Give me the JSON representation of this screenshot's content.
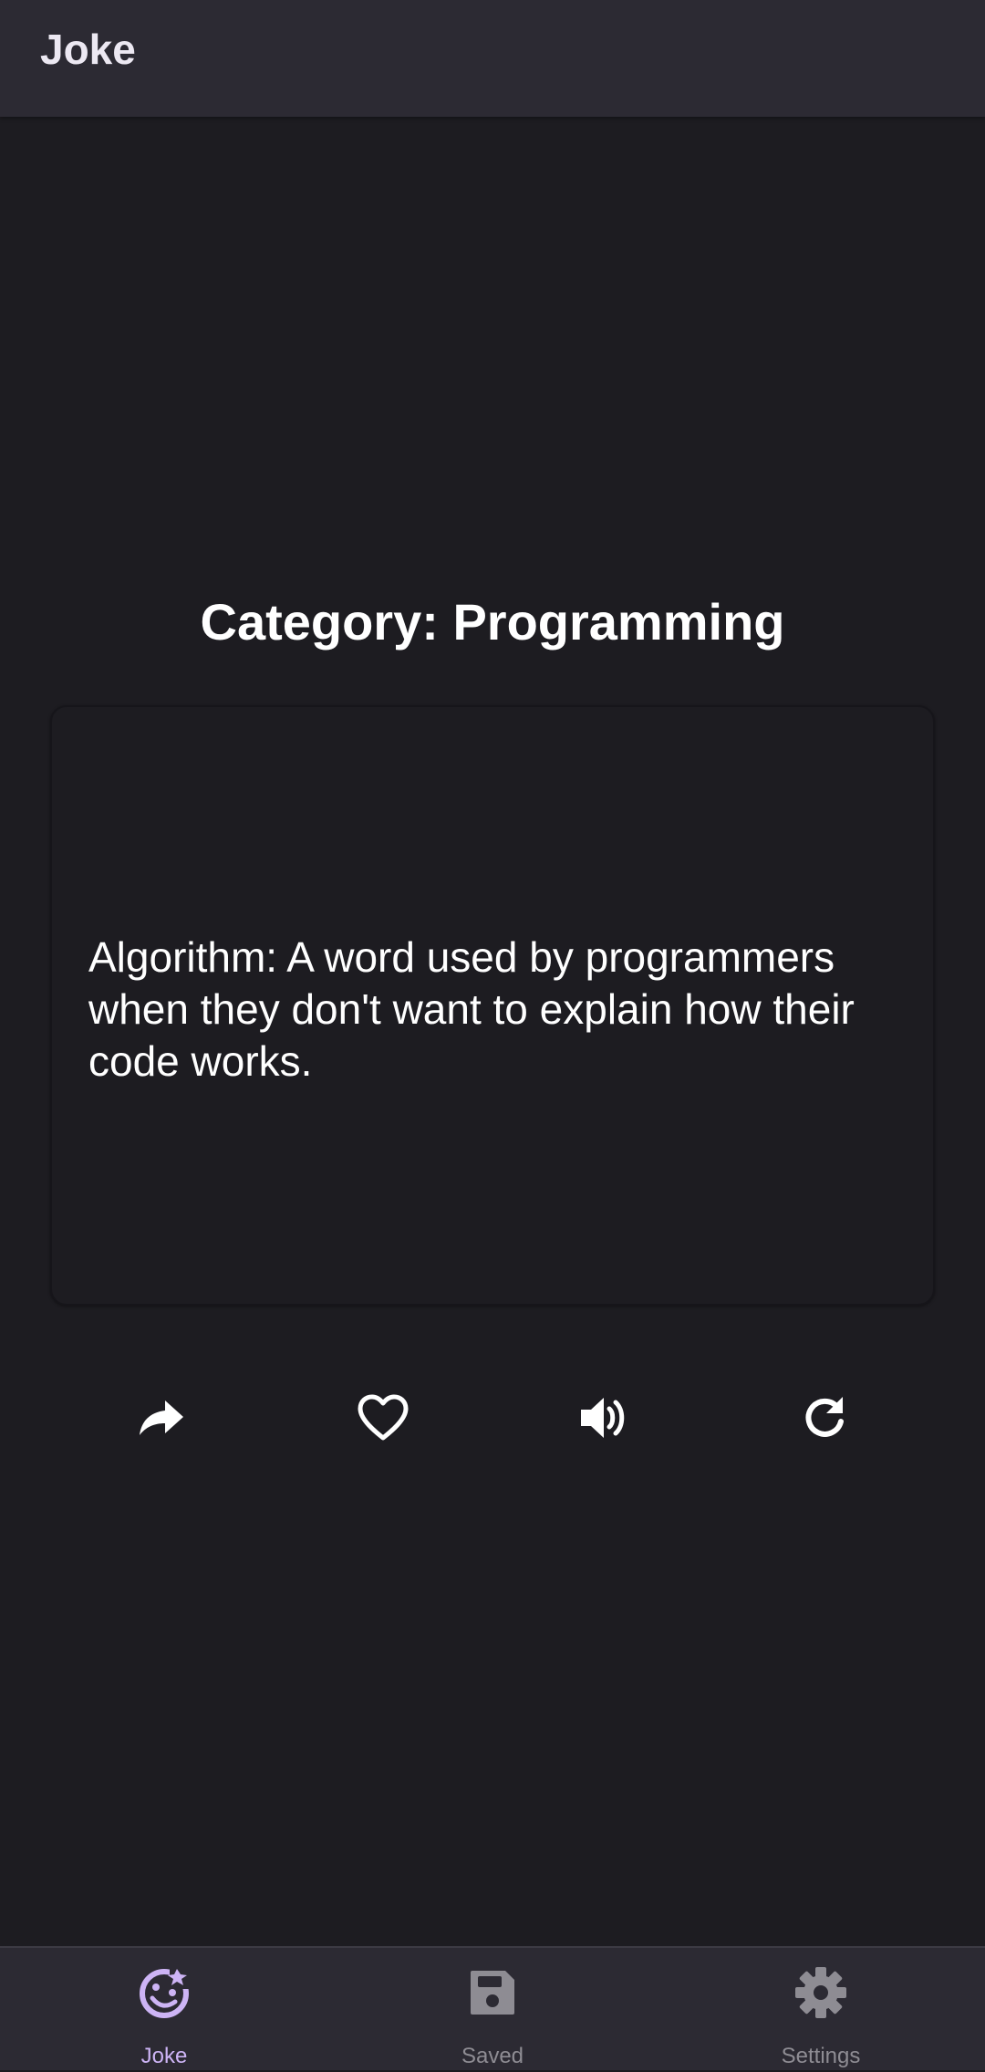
{
  "appbar": {
    "title": "Joke"
  },
  "joke": {
    "category": "Category: Programming",
    "text": "Algorithm: A word used by programmers when they don't want to explain how their code works."
  },
  "actions": [
    {
      "icon": "share-icon"
    },
    {
      "icon": "heart-outline-icon"
    },
    {
      "icon": "volume-icon"
    },
    {
      "icon": "refresh-icon"
    }
  ],
  "bottom_nav": {
    "items": [
      {
        "label": "Joke",
        "icon": "joke-face-icon",
        "active": true
      },
      {
        "label": "Saved",
        "icon": "save-icon",
        "active": false
      },
      {
        "label": "Settings",
        "icon": "gear-icon",
        "active": false
      }
    ]
  },
  "colors": {
    "background": "#1d1c21",
    "surface": "#2c2a33",
    "active": "#cdb4f5",
    "inactive": "#8e8c93",
    "text": "#ffffff"
  }
}
